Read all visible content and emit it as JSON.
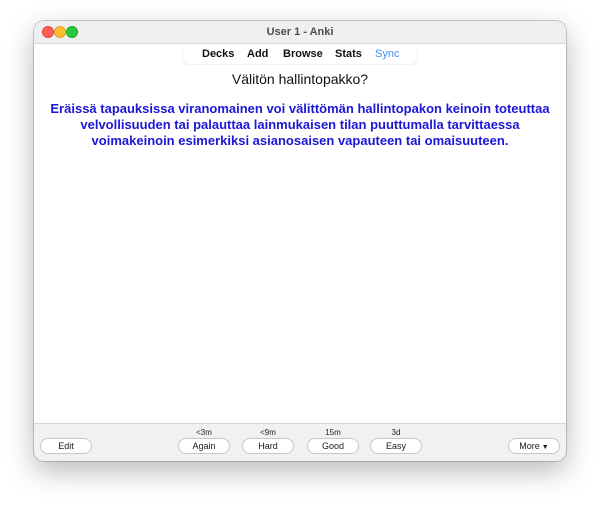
{
  "window": {
    "title": "User 1 - Anki"
  },
  "toolbar": {
    "decks": "Decks",
    "add": "Add",
    "browse": "Browse",
    "stats": "Stats",
    "sync": "Sync"
  },
  "card": {
    "question": "Välitön hallintopakko?",
    "answer": "Eräissä tapauksissa viranomainen voi välittömän hallintopakon keinoin toteuttaa velvollisuuden tai palauttaa lainmukaisen tilan puuttumalla tarvittaessa voimakeinoin esimerkiksi asianosaisen vapauteen tai omaisuuteen."
  },
  "bottom": {
    "edit_label": "Edit",
    "more_label": "More",
    "answers": [
      {
        "interval": "<3m",
        "label": "Again"
      },
      {
        "interval": "<9m",
        "label": "Hard"
      },
      {
        "interval": "15m",
        "label": "Good"
      },
      {
        "interval": "3d",
        "label": "Easy"
      }
    ]
  },
  "colors": {
    "answer_text": "#1b17d6",
    "sync_accent": "#3d8cf7",
    "traffic_close": "#fe5f57",
    "traffic_minimize": "#febc2e",
    "traffic_zoom": "#28c840"
  },
  "icons": {
    "more_caret": "chevron-down-icon"
  }
}
